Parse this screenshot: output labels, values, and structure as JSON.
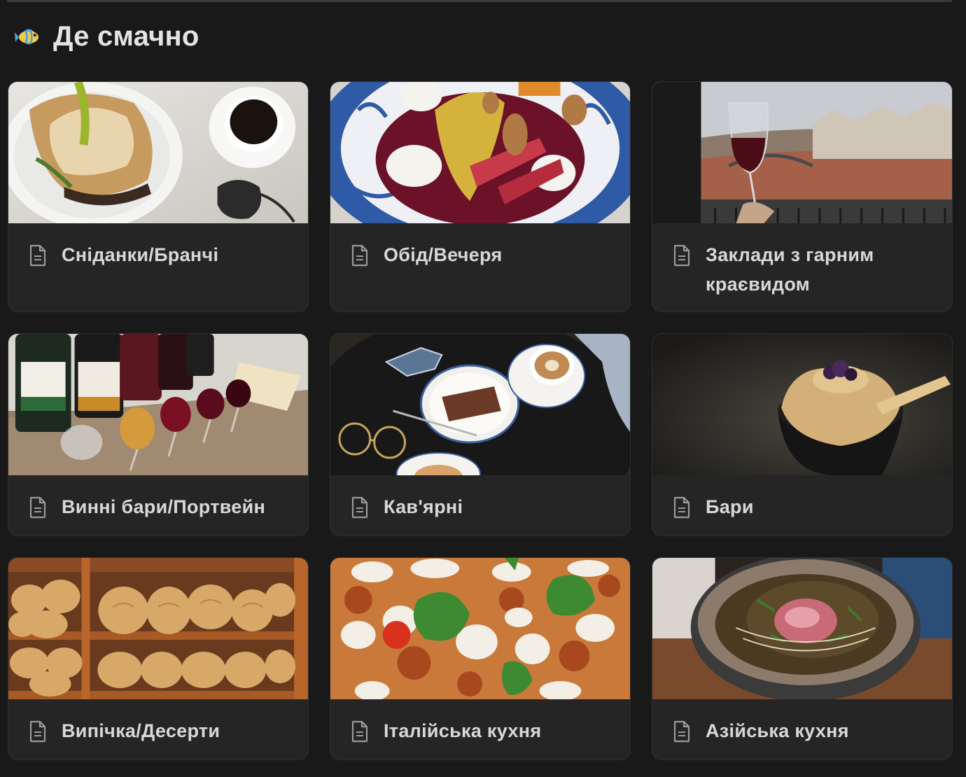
{
  "page": {
    "title": "Де смачно",
    "icon": "tropical-fish-icon"
  },
  "cards": [
    {
      "title": "Сніданки/Бранчі",
      "icon": "page-icon",
      "image": "sandwich-and-coffee-photo"
    },
    {
      "title": "Обід/Вечеря",
      "icon": "page-icon",
      "image": "beet-salad-photo"
    },
    {
      "title": "Заклади з гарним краєвидом",
      "icon": "page-icon",
      "image": "wine-glass-city-view-photo"
    },
    {
      "title": "Винні бари/Портвейн",
      "icon": "page-icon",
      "image": "port-wine-tasting-photo"
    },
    {
      "title": "Кав'ярні",
      "icon": "page-icon",
      "image": "coffee-and-cake-photo"
    },
    {
      "title": "Бари",
      "icon": "page-icon",
      "image": "dessert-cocktail-photo"
    },
    {
      "title": "Випічка/Десерти",
      "icon": "page-icon",
      "image": "bread-bakery-photo"
    },
    {
      "title": "Італійська кухня",
      "icon": "page-icon",
      "image": "pizza-photo"
    },
    {
      "title": "Азійська кухня",
      "icon": "page-icon",
      "image": "pho-soup-photo"
    }
  ],
  "colors": {
    "background": "#191919",
    "card": "#252525",
    "text": "#e6e6e6"
  }
}
